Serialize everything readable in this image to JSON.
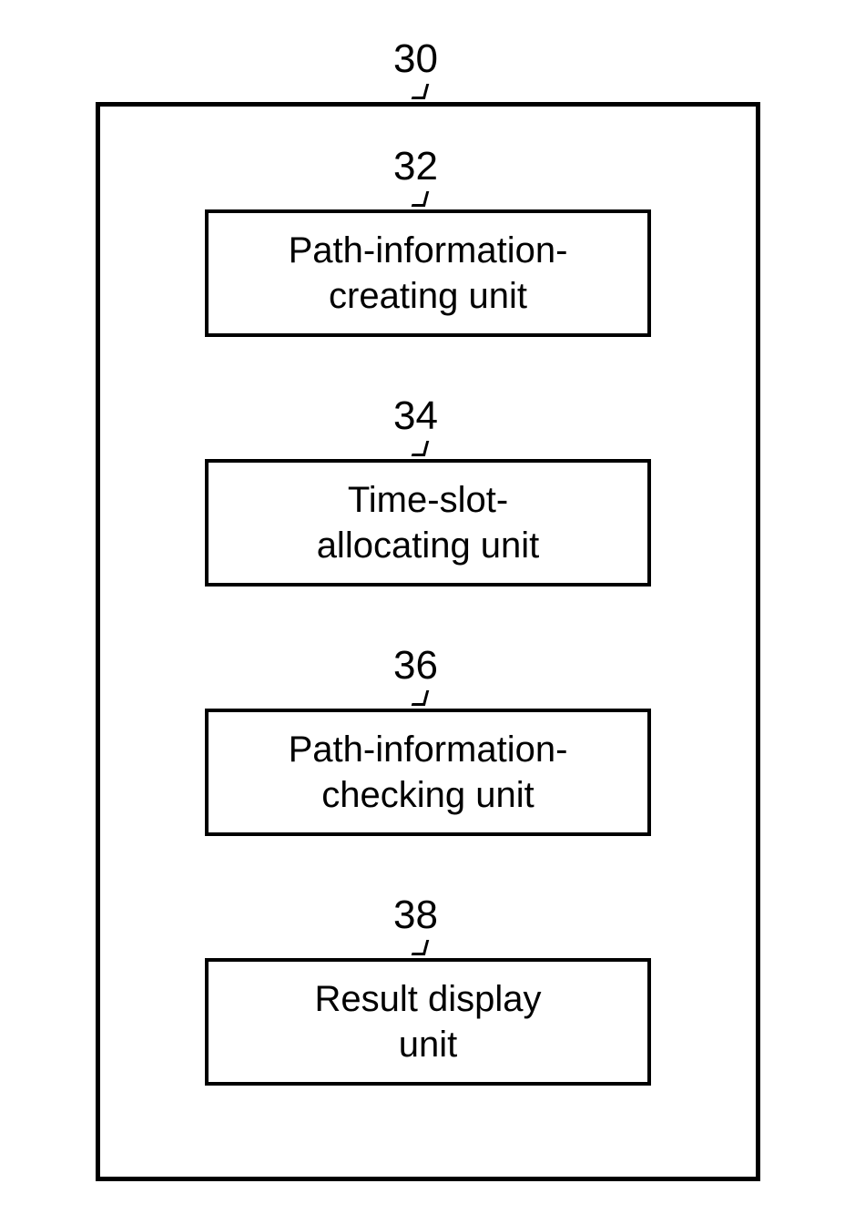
{
  "outer": {
    "label": "30"
  },
  "blocks": [
    {
      "label": "32",
      "text": "Path-information-\ncreating unit"
    },
    {
      "label": "34",
      "text": "Time-slot-\nallocating unit"
    },
    {
      "label": "36",
      "text": "Path-information-\nchecking unit"
    },
    {
      "label": "38",
      "text": "Result display\nunit"
    }
  ]
}
